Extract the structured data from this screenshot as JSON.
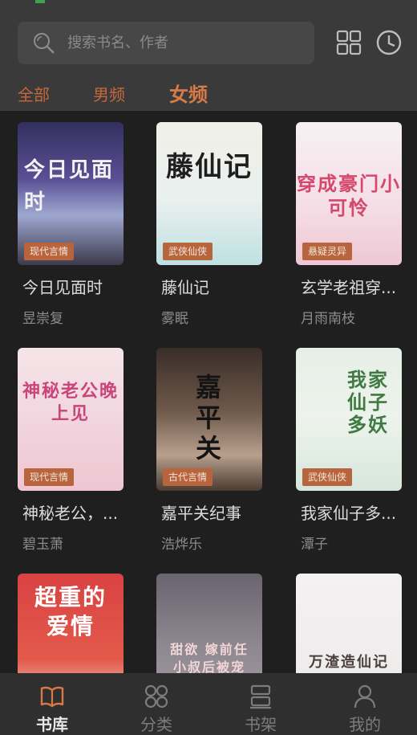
{
  "search": {
    "placeholder": "搜索书名、作者",
    "icon": "search-icon"
  },
  "header_icons": [
    "grid-icon",
    "history-clock-icon"
  ],
  "tabs": [
    {
      "label": "全部",
      "active": false
    },
    {
      "label": "男频",
      "active": false
    },
    {
      "label": "女频",
      "active": true
    }
  ],
  "books": [
    {
      "title": "今日见面时",
      "author": "昱崇复",
      "tag": "现代言情",
      "cover_text": "今日见面时"
    },
    {
      "title": "藤仙记",
      "author": "雾眠",
      "tag": "武侠仙侠",
      "cover_text": "藤仙记"
    },
    {
      "title": "玄学老祖穿...",
      "author": "月雨南枝",
      "tag": "悬疑灵异",
      "cover_text": "穿成豪门小可怜"
    },
    {
      "title": "神秘老公，...",
      "author": "碧玉萧",
      "tag": "现代言情",
      "cover_text": "神秘老公晚上见"
    },
    {
      "title": "嘉平关纪事",
      "author": "浩烨乐",
      "tag": "古代言情",
      "cover_text": "嘉平关"
    },
    {
      "title": "我家仙子多...",
      "author": "潭子",
      "tag": "武侠仙侠",
      "cover_text": "我家仙子多妖"
    },
    {
      "title": "",
      "author": "",
      "tag": "",
      "cover_text": "超重的爱情"
    },
    {
      "title": "",
      "author": "",
      "tag": "",
      "cover_text": "甜欲 嫁前任 小叔后被宠"
    },
    {
      "title": "",
      "author": "",
      "tag": "",
      "cover_text": "万渣造仙记"
    }
  ],
  "nav": [
    {
      "label": "书库",
      "icon": "book-open-icon",
      "active": true
    },
    {
      "label": "分类",
      "icon": "category-icon",
      "active": false
    },
    {
      "label": "书架",
      "icon": "bookshelf-icon",
      "active": false
    },
    {
      "label": "我的",
      "icon": "profile-icon",
      "active": false
    }
  ],
  "colors": {
    "accent": "#d77a45",
    "tag_bg": "#b8643c",
    "header_bg": "#3a3a3a",
    "body_bg": "#1f1f1f"
  }
}
